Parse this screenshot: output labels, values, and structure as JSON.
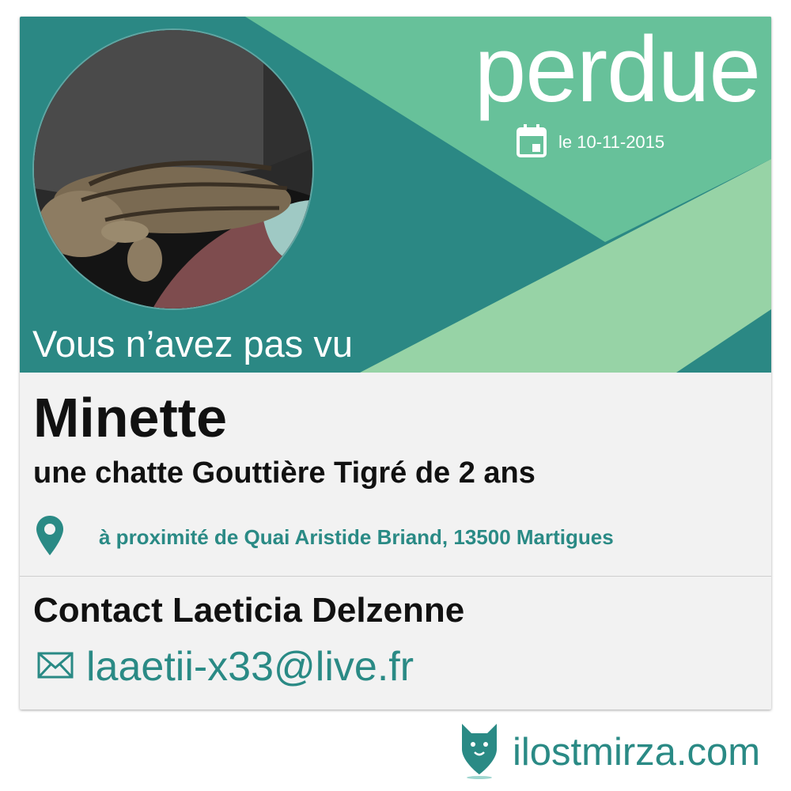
{
  "banner": {
    "status": "perdue",
    "date_label": "le 10-11-2015",
    "intro": "Vous n’avez pas vu",
    "colors": {
      "teal": "#2b8884",
      "green": "#67c19a",
      "light_green": "#97d3a6"
    }
  },
  "pet": {
    "name": "Minette",
    "description": "une chatte Gouttière Tigré de 2 ans",
    "location": "à proximité de Quai Aristide Briand, 13500 Martigues"
  },
  "contact": {
    "label": "Contact Laeticia Delzenne",
    "email": "laaetii-x33@live.fr"
  },
  "footer": {
    "brand": "ilostmirza.com"
  },
  "icons": {
    "calendar": "calendar-icon",
    "location": "map-pin-icon",
    "email": "envelope-icon",
    "brand": "cat-pin-logo-icon"
  },
  "accent_color": "#2a8a85"
}
